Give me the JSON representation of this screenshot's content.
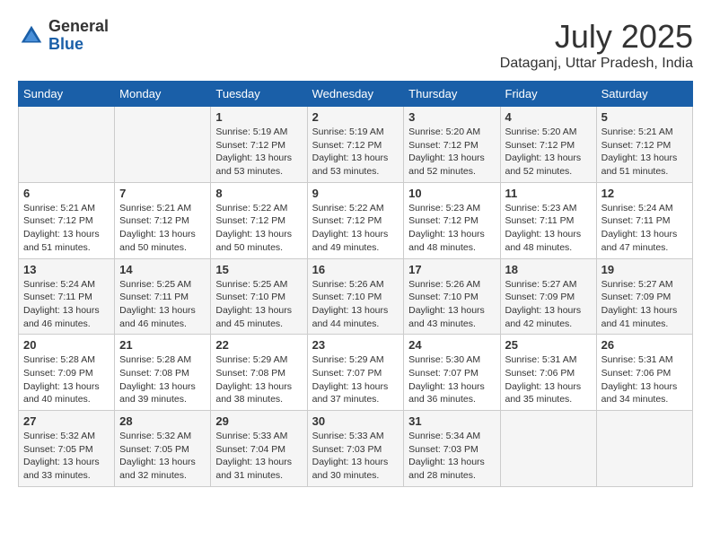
{
  "header": {
    "logo_general": "General",
    "logo_blue": "Blue",
    "month_year": "July 2025",
    "location": "Dataganj, Uttar Pradesh, India"
  },
  "days_of_week": [
    "Sunday",
    "Monday",
    "Tuesday",
    "Wednesday",
    "Thursday",
    "Friday",
    "Saturday"
  ],
  "weeks": [
    [
      {
        "day": "",
        "info": ""
      },
      {
        "day": "",
        "info": ""
      },
      {
        "day": "1",
        "sunrise": "Sunrise: 5:19 AM",
        "sunset": "Sunset: 7:12 PM",
        "daylight": "Daylight: 13 hours and 53 minutes."
      },
      {
        "day": "2",
        "sunrise": "Sunrise: 5:19 AM",
        "sunset": "Sunset: 7:12 PM",
        "daylight": "Daylight: 13 hours and 53 minutes."
      },
      {
        "day": "3",
        "sunrise": "Sunrise: 5:20 AM",
        "sunset": "Sunset: 7:12 PM",
        "daylight": "Daylight: 13 hours and 52 minutes."
      },
      {
        "day": "4",
        "sunrise": "Sunrise: 5:20 AM",
        "sunset": "Sunset: 7:12 PM",
        "daylight": "Daylight: 13 hours and 52 minutes."
      },
      {
        "day": "5",
        "sunrise": "Sunrise: 5:21 AM",
        "sunset": "Sunset: 7:12 PM",
        "daylight": "Daylight: 13 hours and 51 minutes."
      }
    ],
    [
      {
        "day": "6",
        "sunrise": "Sunrise: 5:21 AM",
        "sunset": "Sunset: 7:12 PM",
        "daylight": "Daylight: 13 hours and 51 minutes."
      },
      {
        "day": "7",
        "sunrise": "Sunrise: 5:21 AM",
        "sunset": "Sunset: 7:12 PM",
        "daylight": "Daylight: 13 hours and 50 minutes."
      },
      {
        "day": "8",
        "sunrise": "Sunrise: 5:22 AM",
        "sunset": "Sunset: 7:12 PM",
        "daylight": "Daylight: 13 hours and 50 minutes."
      },
      {
        "day": "9",
        "sunrise": "Sunrise: 5:22 AM",
        "sunset": "Sunset: 7:12 PM",
        "daylight": "Daylight: 13 hours and 49 minutes."
      },
      {
        "day": "10",
        "sunrise": "Sunrise: 5:23 AM",
        "sunset": "Sunset: 7:12 PM",
        "daylight": "Daylight: 13 hours and 48 minutes."
      },
      {
        "day": "11",
        "sunrise": "Sunrise: 5:23 AM",
        "sunset": "Sunset: 7:11 PM",
        "daylight": "Daylight: 13 hours and 48 minutes."
      },
      {
        "day": "12",
        "sunrise": "Sunrise: 5:24 AM",
        "sunset": "Sunset: 7:11 PM",
        "daylight": "Daylight: 13 hours and 47 minutes."
      }
    ],
    [
      {
        "day": "13",
        "sunrise": "Sunrise: 5:24 AM",
        "sunset": "Sunset: 7:11 PM",
        "daylight": "Daylight: 13 hours and 46 minutes."
      },
      {
        "day": "14",
        "sunrise": "Sunrise: 5:25 AM",
        "sunset": "Sunset: 7:11 PM",
        "daylight": "Daylight: 13 hours and 46 minutes."
      },
      {
        "day": "15",
        "sunrise": "Sunrise: 5:25 AM",
        "sunset": "Sunset: 7:10 PM",
        "daylight": "Daylight: 13 hours and 45 minutes."
      },
      {
        "day": "16",
        "sunrise": "Sunrise: 5:26 AM",
        "sunset": "Sunset: 7:10 PM",
        "daylight": "Daylight: 13 hours and 44 minutes."
      },
      {
        "day": "17",
        "sunrise": "Sunrise: 5:26 AM",
        "sunset": "Sunset: 7:10 PM",
        "daylight": "Daylight: 13 hours and 43 minutes."
      },
      {
        "day": "18",
        "sunrise": "Sunrise: 5:27 AM",
        "sunset": "Sunset: 7:09 PM",
        "daylight": "Daylight: 13 hours and 42 minutes."
      },
      {
        "day": "19",
        "sunrise": "Sunrise: 5:27 AM",
        "sunset": "Sunset: 7:09 PM",
        "daylight": "Daylight: 13 hours and 41 minutes."
      }
    ],
    [
      {
        "day": "20",
        "sunrise": "Sunrise: 5:28 AM",
        "sunset": "Sunset: 7:09 PM",
        "daylight": "Daylight: 13 hours and 40 minutes."
      },
      {
        "day": "21",
        "sunrise": "Sunrise: 5:28 AM",
        "sunset": "Sunset: 7:08 PM",
        "daylight": "Daylight: 13 hours and 39 minutes."
      },
      {
        "day": "22",
        "sunrise": "Sunrise: 5:29 AM",
        "sunset": "Sunset: 7:08 PM",
        "daylight": "Daylight: 13 hours and 38 minutes."
      },
      {
        "day": "23",
        "sunrise": "Sunrise: 5:29 AM",
        "sunset": "Sunset: 7:07 PM",
        "daylight": "Daylight: 13 hours and 37 minutes."
      },
      {
        "day": "24",
        "sunrise": "Sunrise: 5:30 AM",
        "sunset": "Sunset: 7:07 PM",
        "daylight": "Daylight: 13 hours and 36 minutes."
      },
      {
        "day": "25",
        "sunrise": "Sunrise: 5:31 AM",
        "sunset": "Sunset: 7:06 PM",
        "daylight": "Daylight: 13 hours and 35 minutes."
      },
      {
        "day": "26",
        "sunrise": "Sunrise: 5:31 AM",
        "sunset": "Sunset: 7:06 PM",
        "daylight": "Daylight: 13 hours and 34 minutes."
      }
    ],
    [
      {
        "day": "27",
        "sunrise": "Sunrise: 5:32 AM",
        "sunset": "Sunset: 7:05 PM",
        "daylight": "Daylight: 13 hours and 33 minutes."
      },
      {
        "day": "28",
        "sunrise": "Sunrise: 5:32 AM",
        "sunset": "Sunset: 7:05 PM",
        "daylight": "Daylight: 13 hours and 32 minutes."
      },
      {
        "day": "29",
        "sunrise": "Sunrise: 5:33 AM",
        "sunset": "Sunset: 7:04 PM",
        "daylight": "Daylight: 13 hours and 31 minutes."
      },
      {
        "day": "30",
        "sunrise": "Sunrise: 5:33 AM",
        "sunset": "Sunset: 7:03 PM",
        "daylight": "Daylight: 13 hours and 30 minutes."
      },
      {
        "day": "31",
        "sunrise": "Sunrise: 5:34 AM",
        "sunset": "Sunset: 7:03 PM",
        "daylight": "Daylight: 13 hours and 28 minutes."
      },
      {
        "day": "",
        "info": ""
      },
      {
        "day": "",
        "info": ""
      }
    ]
  ]
}
